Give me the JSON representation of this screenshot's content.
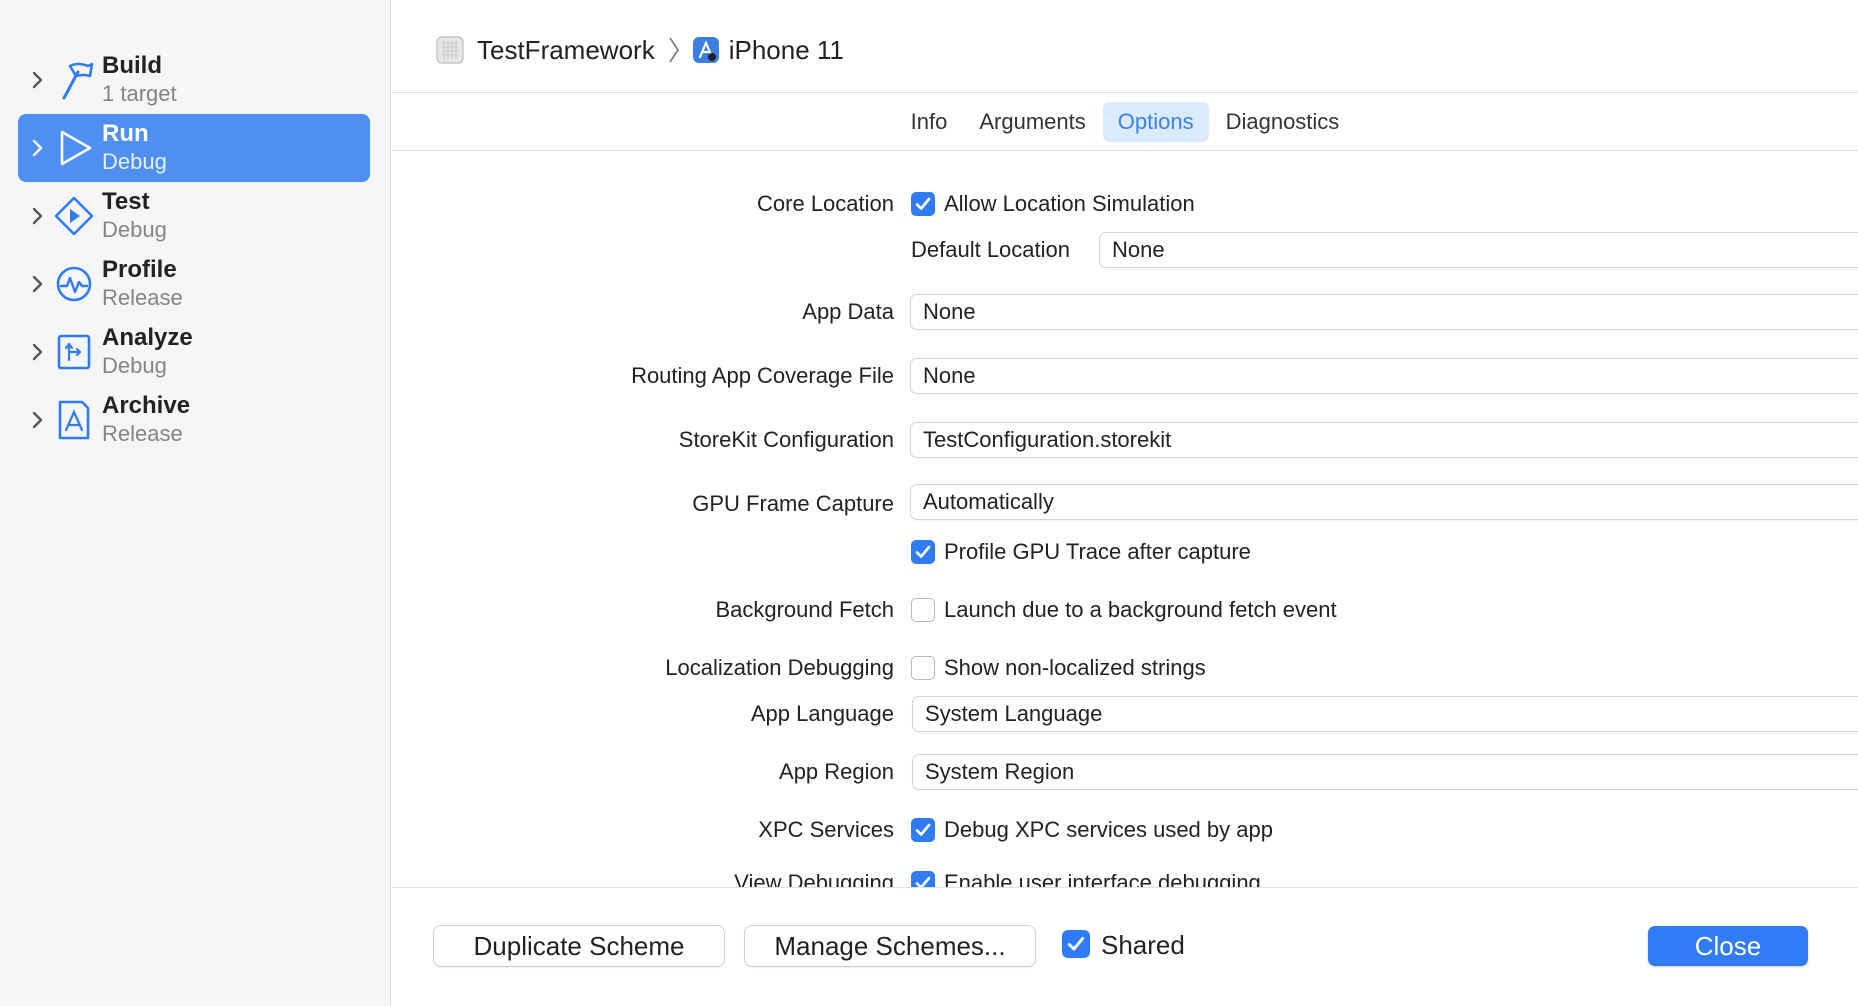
{
  "sidebar": {
    "items": [
      {
        "title": "Build",
        "subtitle": "1 target",
        "icon": "hammer-icon"
      },
      {
        "title": "Run",
        "subtitle": "Debug",
        "icon": "play-icon",
        "selected": true
      },
      {
        "title": "Test",
        "subtitle": "Debug",
        "icon": "test-diamond-icon"
      },
      {
        "title": "Profile",
        "subtitle": "Release",
        "icon": "waveform-icon"
      },
      {
        "title": "Analyze",
        "subtitle": "Debug",
        "icon": "analyze-icon"
      },
      {
        "title": "Archive",
        "subtitle": "Release",
        "icon": "archive-app-icon"
      }
    ]
  },
  "breadcrumb": {
    "project": "TestFramework",
    "device": "iPhone 11"
  },
  "tabs": [
    "Info",
    "Arguments",
    "Options",
    "Diagnostics"
  ],
  "active_tab": "Options",
  "options": {
    "core_location_label": "Core Location",
    "allow_location_simulation": {
      "label": "Allow Location Simulation",
      "checked": true
    },
    "default_location_label": "Default Location",
    "default_location_value": "None",
    "app_data_label": "App Data",
    "app_data_value": "None",
    "routing_label": "Routing App Coverage File",
    "routing_value": "None",
    "storekit_label": "StoreKit Configuration",
    "storekit_value": "TestConfiguration.storekit",
    "gpu_label": "GPU Frame Capture",
    "gpu_value": "Automatically",
    "profile_gpu": {
      "label": "Profile GPU Trace after capture",
      "checked": true
    },
    "bg_fetch_label": "Background Fetch",
    "bg_fetch": {
      "label": "Launch due to a background fetch event",
      "checked": false
    },
    "loc_debug_label": "Localization Debugging",
    "loc_debug": {
      "label": "Show non-localized strings",
      "checked": false
    },
    "app_language_label": "App Language",
    "app_language_value": "System Language",
    "app_region_label": "App Region",
    "app_region_value": "System Region",
    "xpc_label": "XPC Services",
    "xpc": {
      "label": "Debug XPC services used by app",
      "checked": true
    },
    "view_debug_label": "View Debugging",
    "view_debug": {
      "label": "Enable user interface debugging",
      "checked": true
    }
  },
  "footer": {
    "duplicate_label": "Duplicate Scheme",
    "manage_label": "Manage Schemes...",
    "shared_label": "Shared",
    "shared_checked": true,
    "close_label": "Close"
  },
  "colors": {
    "accent": "#2f7cf6",
    "selected_row": "#4f8ff0",
    "active_tab_bg": "#dceafd"
  }
}
